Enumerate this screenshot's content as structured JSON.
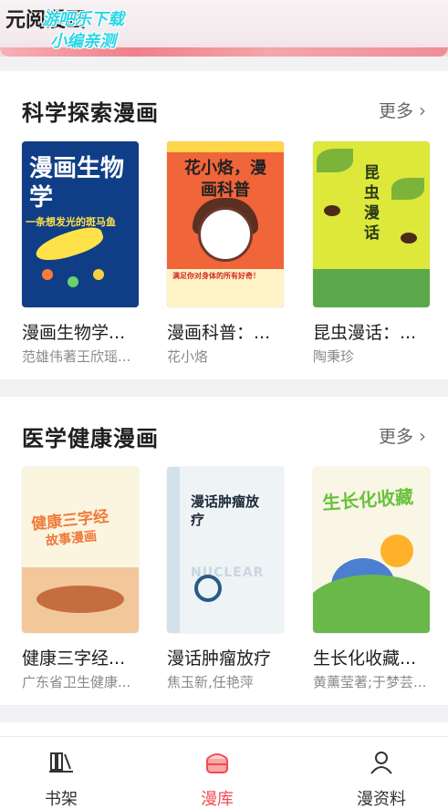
{
  "header": {
    "title": "元阅漫画",
    "watermark_line1": "游吧乐下载",
    "watermark_line2": "小编亲测"
  },
  "sections": [
    {
      "title": "科学探索漫画",
      "more": "更多",
      "books": [
        {
          "title": "漫画生物学...",
          "author": "范雄伟著王欣瑶...",
          "cover_text": "漫画生物学",
          "cover_sub": "一条想发光的斑马鱼"
        },
        {
          "title": "漫画科普：...",
          "author": "花小烙",
          "cover_text": "花小烙，漫画科普",
          "cover_sub": "满足你对身体的所有好奇！"
        },
        {
          "title": "昆虫漫话：...",
          "author": "陶秉珍",
          "cover_text": "昆虫漫话"
        }
      ]
    },
    {
      "title": "医学健康漫画",
      "more": "更多",
      "books": [
        {
          "title": "健康三字经...",
          "author": "广东省卫生健康...",
          "cover_text": "健康三字经",
          "cover_sub": "故事漫画"
        },
        {
          "title": "漫话肿瘤放疗",
          "author": "焦玉新,任艳萍",
          "cover_text": "漫话肿瘤放疗",
          "cover_sub": "NUCLEAR"
        },
        {
          "title": "生长化收藏...",
          "author": "黄薰莹著;于梦芸...",
          "cover_text": "生长化收藏"
        }
      ]
    }
  ],
  "tabbar": [
    {
      "label": "书架",
      "icon": "bookshelf-icon",
      "active": false
    },
    {
      "label": "漫库",
      "icon": "comic-library-icon",
      "active": true
    },
    {
      "label": "漫资料",
      "icon": "profile-icon",
      "active": false
    }
  ],
  "colors": {
    "accent": "#f04b55",
    "text": "#1e1e1e",
    "muted": "#8a8a8a"
  }
}
